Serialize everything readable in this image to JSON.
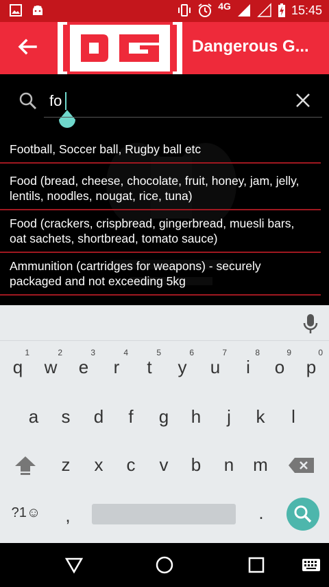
{
  "status_bar": {
    "network": "4G",
    "time": "15:45"
  },
  "app_bar": {
    "logo_text": "DG",
    "title": "Dangerous G..."
  },
  "search": {
    "value": "fo",
    "placeholder": ""
  },
  "results": [
    {
      "line1": "Football, Soccer ball, Rugby ball etc",
      "line2": ""
    },
    {
      "line1": "Food (bread, cheese, chocolate, fruit, honey, jam, jelly,",
      "line2": "lentils, noodles, nougat, rice, tuna)"
    },
    {
      "line1": "Food (crackers, crispbread, gingerbread, muesli bars,",
      "line2": "oat sachets, shortbread, tomato sauce)"
    },
    {
      "line1": "Ammunition (cartridges for weapons) - securely",
      "line2": "packaged and not exceeding 5kg"
    }
  ],
  "keyboard": {
    "row1": [
      {
        "key": "q",
        "hint": "1"
      },
      {
        "key": "w",
        "hint": "2"
      },
      {
        "key": "e",
        "hint": "3"
      },
      {
        "key": "r",
        "hint": "4"
      },
      {
        "key": "t",
        "hint": "5"
      },
      {
        "key": "y",
        "hint": "6"
      },
      {
        "key": "u",
        "hint": "7"
      },
      {
        "key": "i",
        "hint": "8"
      },
      {
        "key": "o",
        "hint": "9"
      },
      {
        "key": "p",
        "hint": "0"
      }
    ],
    "row2": [
      "a",
      "s",
      "d",
      "f",
      "g",
      "h",
      "j",
      "k",
      "l"
    ],
    "row3": [
      "z",
      "x",
      "c",
      "v",
      "b",
      "n",
      "m"
    ],
    "symbols_key": "?1☺",
    "comma_key": ",",
    "period_key": "."
  },
  "colors": {
    "app_bar": "#ee2a3a",
    "status_bar": "#c4161c",
    "accent": "#4db6ac",
    "divider": "#a01820"
  }
}
